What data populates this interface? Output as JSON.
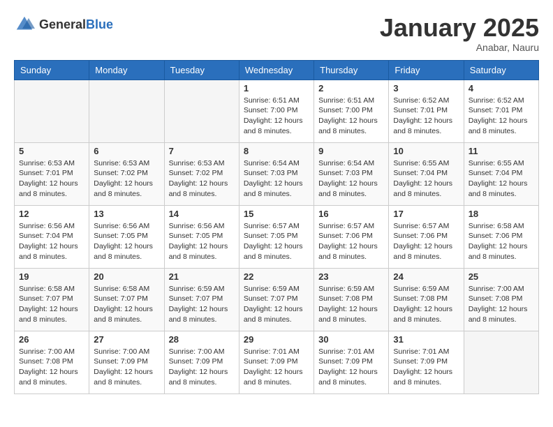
{
  "logo": {
    "general": "General",
    "blue": "Blue"
  },
  "title": "January 2025",
  "location": "Anabar, Nauru",
  "days_of_week": [
    "Sunday",
    "Monday",
    "Tuesday",
    "Wednesday",
    "Thursday",
    "Friday",
    "Saturday"
  ],
  "weeks": [
    {
      "days": [
        {
          "num": "",
          "info": ""
        },
        {
          "num": "",
          "info": ""
        },
        {
          "num": "",
          "info": ""
        },
        {
          "num": "1",
          "info": "Sunrise: 6:51 AM\nSunset: 7:00 PM\nDaylight: 12 hours and 8 minutes."
        },
        {
          "num": "2",
          "info": "Sunrise: 6:51 AM\nSunset: 7:00 PM\nDaylight: 12 hours and 8 minutes."
        },
        {
          "num": "3",
          "info": "Sunrise: 6:52 AM\nSunset: 7:01 PM\nDaylight: 12 hours and 8 minutes."
        },
        {
          "num": "4",
          "info": "Sunrise: 6:52 AM\nSunset: 7:01 PM\nDaylight: 12 hours and 8 minutes."
        }
      ]
    },
    {
      "days": [
        {
          "num": "5",
          "info": "Sunrise: 6:53 AM\nSunset: 7:01 PM\nDaylight: 12 hours and 8 minutes."
        },
        {
          "num": "6",
          "info": "Sunrise: 6:53 AM\nSunset: 7:02 PM\nDaylight: 12 hours and 8 minutes."
        },
        {
          "num": "7",
          "info": "Sunrise: 6:53 AM\nSunset: 7:02 PM\nDaylight: 12 hours and 8 minutes."
        },
        {
          "num": "8",
          "info": "Sunrise: 6:54 AM\nSunset: 7:03 PM\nDaylight: 12 hours and 8 minutes."
        },
        {
          "num": "9",
          "info": "Sunrise: 6:54 AM\nSunset: 7:03 PM\nDaylight: 12 hours and 8 minutes."
        },
        {
          "num": "10",
          "info": "Sunrise: 6:55 AM\nSunset: 7:04 PM\nDaylight: 12 hours and 8 minutes."
        },
        {
          "num": "11",
          "info": "Sunrise: 6:55 AM\nSunset: 7:04 PM\nDaylight: 12 hours and 8 minutes."
        }
      ]
    },
    {
      "days": [
        {
          "num": "12",
          "info": "Sunrise: 6:56 AM\nSunset: 7:04 PM\nDaylight: 12 hours and 8 minutes."
        },
        {
          "num": "13",
          "info": "Sunrise: 6:56 AM\nSunset: 7:05 PM\nDaylight: 12 hours and 8 minutes."
        },
        {
          "num": "14",
          "info": "Sunrise: 6:56 AM\nSunset: 7:05 PM\nDaylight: 12 hours and 8 minutes."
        },
        {
          "num": "15",
          "info": "Sunrise: 6:57 AM\nSunset: 7:05 PM\nDaylight: 12 hours and 8 minutes."
        },
        {
          "num": "16",
          "info": "Sunrise: 6:57 AM\nSunset: 7:06 PM\nDaylight: 12 hours and 8 minutes."
        },
        {
          "num": "17",
          "info": "Sunrise: 6:57 AM\nSunset: 7:06 PM\nDaylight: 12 hours and 8 minutes."
        },
        {
          "num": "18",
          "info": "Sunrise: 6:58 AM\nSunset: 7:06 PM\nDaylight: 12 hours and 8 minutes."
        }
      ]
    },
    {
      "days": [
        {
          "num": "19",
          "info": "Sunrise: 6:58 AM\nSunset: 7:07 PM\nDaylight: 12 hours and 8 minutes."
        },
        {
          "num": "20",
          "info": "Sunrise: 6:58 AM\nSunset: 7:07 PM\nDaylight: 12 hours and 8 minutes."
        },
        {
          "num": "21",
          "info": "Sunrise: 6:59 AM\nSunset: 7:07 PM\nDaylight: 12 hours and 8 minutes."
        },
        {
          "num": "22",
          "info": "Sunrise: 6:59 AM\nSunset: 7:07 PM\nDaylight: 12 hours and 8 minutes."
        },
        {
          "num": "23",
          "info": "Sunrise: 6:59 AM\nSunset: 7:08 PM\nDaylight: 12 hours and 8 minutes."
        },
        {
          "num": "24",
          "info": "Sunrise: 6:59 AM\nSunset: 7:08 PM\nDaylight: 12 hours and 8 minutes."
        },
        {
          "num": "25",
          "info": "Sunrise: 7:00 AM\nSunset: 7:08 PM\nDaylight: 12 hours and 8 minutes."
        }
      ]
    },
    {
      "days": [
        {
          "num": "26",
          "info": "Sunrise: 7:00 AM\nSunset: 7:08 PM\nDaylight: 12 hours and 8 minutes."
        },
        {
          "num": "27",
          "info": "Sunrise: 7:00 AM\nSunset: 7:09 PM\nDaylight: 12 hours and 8 minutes."
        },
        {
          "num": "28",
          "info": "Sunrise: 7:00 AM\nSunset: 7:09 PM\nDaylight: 12 hours and 8 minutes."
        },
        {
          "num": "29",
          "info": "Sunrise: 7:01 AM\nSunset: 7:09 PM\nDaylight: 12 hours and 8 minutes."
        },
        {
          "num": "30",
          "info": "Sunrise: 7:01 AM\nSunset: 7:09 PM\nDaylight: 12 hours and 8 minutes."
        },
        {
          "num": "31",
          "info": "Sunrise: 7:01 AM\nSunset: 7:09 PM\nDaylight: 12 hours and 8 minutes."
        },
        {
          "num": "",
          "info": ""
        }
      ]
    }
  ]
}
